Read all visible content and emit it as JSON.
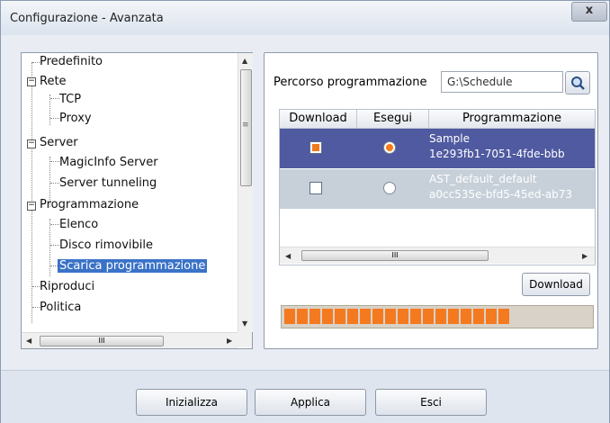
{
  "window": {
    "title": "Configurazione - Avanzata",
    "close_label": "x"
  },
  "tree": {
    "items": [
      {
        "label": "Predefinito"
      },
      {
        "label": "Rete"
      },
      {
        "label": "TCP"
      },
      {
        "label": "Proxy"
      },
      {
        "label": "Server"
      },
      {
        "label": "MagicInfo Server"
      },
      {
        "label": "Server tunneling"
      },
      {
        "label": "Programmazione"
      },
      {
        "label": "Elenco"
      },
      {
        "label": "Disco rimovibile"
      },
      {
        "label": "Scarica programmazione",
        "selected": true
      },
      {
        "label": "Riproduci"
      },
      {
        "label": "Politica"
      }
    ],
    "expand_sign": "−",
    "scroll_grip": "≡",
    "hscroll_grip": "III"
  },
  "schedule": {
    "path_label": "Percorso programmazione",
    "path_value": "G:\\Schedule",
    "columns": [
      "Download",
      "Esegui",
      "Programmazione"
    ],
    "rows": [
      {
        "download": true,
        "execute": true,
        "name": "Sample",
        "id": "1e293fb1-7051-4fde-bbb"
      },
      {
        "download": false,
        "execute": false,
        "name": "AST_default_default",
        "id": "a0cc535e-bfd5-45ed-ab73"
      }
    ],
    "hscroll_grip": "III",
    "download_button": "Download",
    "progress_fraction": 0.75,
    "colors": {
      "selected_row": "#4f5aa0",
      "progress": "#f47a20",
      "check_fill": "#f07a1e"
    }
  },
  "buttons": {
    "reset": "Inizializza",
    "apply": "Applica",
    "exit": "Esci"
  },
  "icons": {
    "search": "magnifier-icon"
  }
}
